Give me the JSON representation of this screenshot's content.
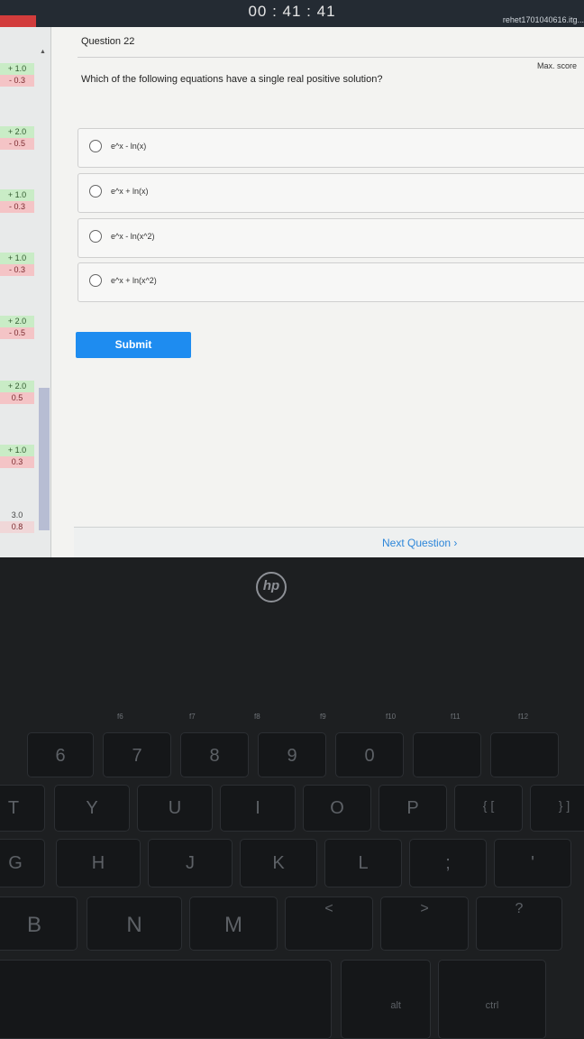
{
  "timer": "00 : 41 : 41",
  "user": "rehet1701040616.itg...",
  "sidebar": {
    "entries": [
      {
        "plus": "+ 1.0",
        "minus": "- 0.3"
      },
      {
        "plus": "+ 2.0",
        "minus": "- 0.5"
      },
      {
        "plus": "+ 1.0",
        "minus": "- 0.3"
      },
      {
        "plus": "+ 1.0",
        "minus": "- 0.3"
      },
      {
        "plus": "+ 2.0",
        "minus": "- 0.5"
      },
      {
        "plus": "+ 2.0",
        "minus": "0.5"
      },
      {
        "plus": "+ 1.0",
        "minus": "0.3"
      },
      {
        "plus": "3.0",
        "minus": "0.8"
      }
    ]
  },
  "question": {
    "label": "Question 22",
    "max_score": "Max. score",
    "text": "Which of the following equations have a single real positive solution?",
    "options": [
      "e^x - ln(x)",
      "e^x + ln(x)",
      "e^x - ln(x^2)",
      "e^x + ln(x^2)"
    ]
  },
  "submit_label": "Submit",
  "next_label": "Next Question",
  "laptop": {
    "logo": "hp",
    "fn_labels": [
      "f6",
      "f7",
      "f8",
      "f9",
      "f10",
      "f11",
      "f12"
    ],
    "keys": {
      "num": [
        "6",
        "7",
        "8",
        "9",
        "0"
      ],
      "top": [
        "T",
        "Y",
        "U",
        "I",
        "O",
        "P",
        "{ [",
        "} ]"
      ],
      "mid": [
        "G",
        "H",
        "J",
        "K",
        "L",
        ";",
        "'"
      ],
      "bottom": [
        "B",
        "N",
        "M",
        "<",
        ">",
        "?"
      ],
      "alt": "alt",
      "ctrl": "ctrl"
    }
  },
  "colors": {
    "accent": "#1e8cf0",
    "link": "#2d86d9",
    "topbar": "#242b33"
  }
}
